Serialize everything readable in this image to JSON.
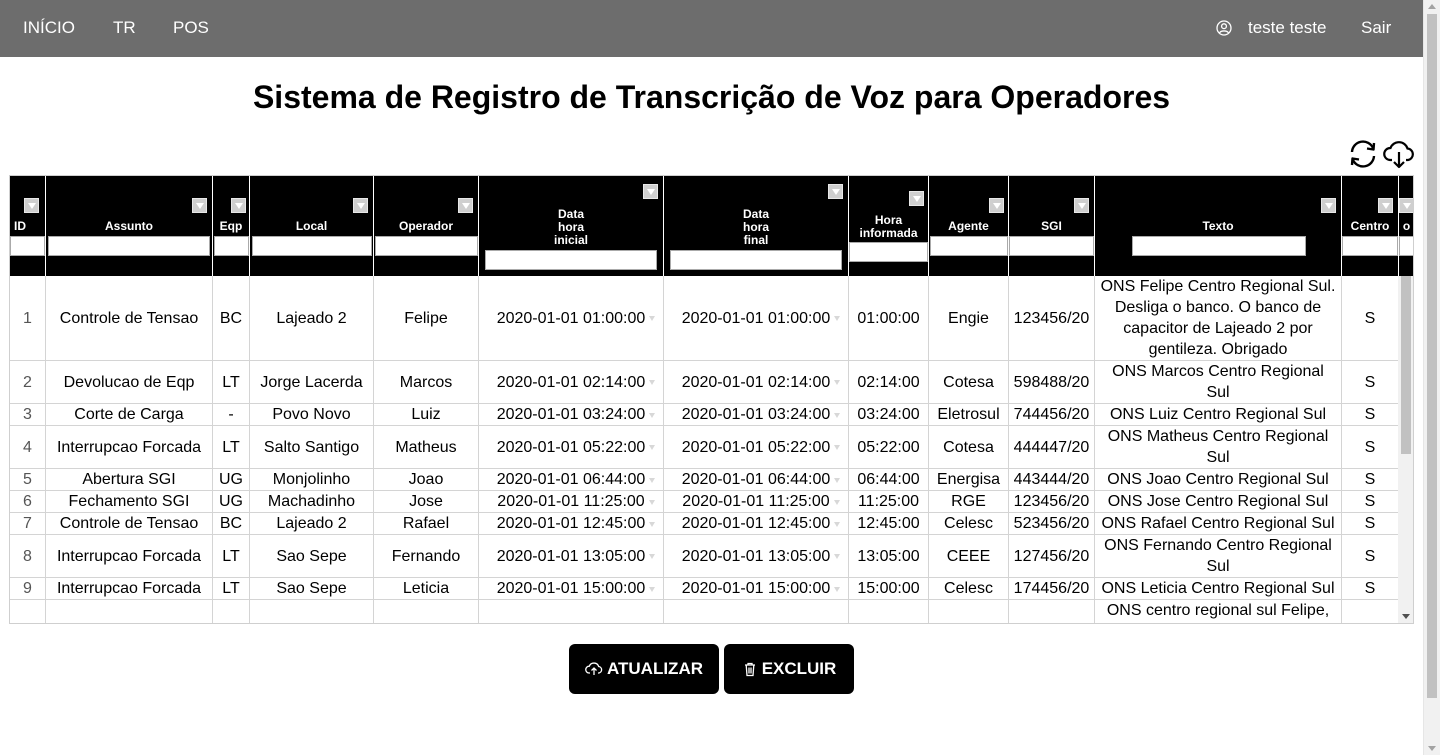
{
  "nav": {
    "links": [
      "INÍCIO",
      "TR",
      "POS"
    ],
    "user_name": "teste teste",
    "logout": "Sair"
  },
  "page_title": "Sistema de Registro de Transcrição de Voz para Operadores",
  "toolbar": {
    "refresh_icon": "refresh-icon",
    "download_icon": "cloud-download-icon"
  },
  "grid": {
    "columns": [
      {
        "key": "id",
        "label": "ID"
      },
      {
        "key": "assunto",
        "label": "Assunto"
      },
      {
        "key": "eqp",
        "label": "Eqp"
      },
      {
        "key": "local",
        "label": "Local"
      },
      {
        "key": "operador",
        "label": "Operador"
      },
      {
        "key": "inicial",
        "label": "Data\nhora\ninicial"
      },
      {
        "key": "final",
        "label": "Data\nhora\nfinal"
      },
      {
        "key": "informada",
        "label": "Hora\ninformada"
      },
      {
        "key": "agente",
        "label": "Agente"
      },
      {
        "key": "sgi",
        "label": "SGI"
      },
      {
        "key": "texto",
        "label": "Texto"
      },
      {
        "key": "centro",
        "label": "Centro"
      },
      {
        "key": "extra",
        "label": "o"
      }
    ],
    "rows": [
      {
        "id": "1",
        "assunto": "Controle de Tensao",
        "eqp": "BC",
        "local": "Lajeado 2",
        "operador": "Felipe",
        "inicial": "2020-01-01 01:00:00",
        "final": "2020-01-01 01:00:00",
        "informada": "01:00:00",
        "agente": "Engie",
        "sgi": "123456/20",
        "texto": "ONS Felipe Centro Regional Sul. Desliga o banco. O banco de capacitor de Lajeado 2 por gentileza. Obrigado",
        "centro": "S"
      },
      {
        "id": "2",
        "assunto": "Devolucao de Eqp",
        "eqp": "LT",
        "local": "Jorge Lacerda",
        "operador": "Marcos",
        "inicial": "2020-01-01 02:14:00",
        "final": "2020-01-01 02:14:00",
        "informada": "02:14:00",
        "agente": "Cotesa",
        "sgi": "598488/20",
        "texto": "ONS Marcos Centro Regional Sul",
        "centro": "S"
      },
      {
        "id": "3",
        "assunto": "Corte de Carga",
        "eqp": "-",
        "local": "Povo Novo",
        "operador": "Luiz",
        "inicial": "2020-01-01 03:24:00",
        "final": "2020-01-01 03:24:00",
        "informada": "03:24:00",
        "agente": "Eletrosul",
        "sgi": "744456/20",
        "texto": "ONS Luiz Centro Regional Sul",
        "centro": "S"
      },
      {
        "id": "4",
        "assunto": "Interrupcao Forcada",
        "eqp": "LT",
        "local": "Salto Santigo",
        "operador": "Matheus",
        "inicial": "2020-01-01 05:22:00",
        "final": "2020-01-01 05:22:00",
        "informada": "05:22:00",
        "agente": "Cotesa",
        "sgi": "444447/20",
        "texto": "ONS Matheus Centro Regional Sul",
        "centro": "S"
      },
      {
        "id": "5",
        "assunto": "Abertura SGI",
        "eqp": "UG",
        "local": "Monjolinho",
        "operador": "Joao",
        "inicial": "2020-01-01 06:44:00",
        "final": "2020-01-01 06:44:00",
        "informada": "06:44:00",
        "agente": "Energisa",
        "sgi": "443444/20",
        "texto": "ONS Joao Centro Regional Sul",
        "centro": "S"
      },
      {
        "id": "6",
        "assunto": "Fechamento SGI",
        "eqp": "UG",
        "local": "Machadinho",
        "operador": "Jose",
        "inicial": "2020-01-01 11:25:00",
        "final": "2020-01-01 11:25:00",
        "informada": "11:25:00",
        "agente": "RGE",
        "sgi": "123456/20",
        "texto": "ONS Jose Centro Regional Sul",
        "centro": "S"
      },
      {
        "id": "7",
        "assunto": "Controle de Tensao",
        "eqp": "BC",
        "local": "Lajeado 2",
        "operador": "Rafael",
        "inicial": "2020-01-01 12:45:00",
        "final": "2020-01-01 12:45:00",
        "informada": "12:45:00",
        "agente": "Celesc",
        "sgi": "523456/20",
        "texto": "ONS Rafael Centro Regional Sul",
        "centro": "S"
      },
      {
        "id": "8",
        "assunto": "Interrupcao Forcada",
        "eqp": "LT",
        "local": "Sao Sepe",
        "operador": "Fernando",
        "inicial": "2020-01-01 13:05:00",
        "final": "2020-01-01 13:05:00",
        "informada": "13:05:00",
        "agente": "CEEE",
        "sgi": "127456/20",
        "texto": "ONS Fernando Centro Regional Sul",
        "centro": "S"
      },
      {
        "id": "9",
        "assunto": "Interrupcao Forcada",
        "eqp": "LT",
        "local": "Sao Sepe",
        "operador": "Leticia",
        "inicial": "2020-01-01 15:00:00",
        "final": "2020-01-01 15:00:00",
        "informada": "15:00:00",
        "agente": "Celesc",
        "sgi": "174456/20",
        "texto": "ONS Leticia Centro Regional Sul",
        "centro": "S"
      },
      {
        "id": "",
        "assunto": "",
        "eqp": "",
        "local": "",
        "operador": "",
        "inicial": "",
        "final": "",
        "informada": "",
        "agente": "",
        "sgi": "",
        "texto": "ONS centro regional sul Felipe,",
        "centro": ""
      }
    ]
  },
  "buttons": {
    "update": "ATUALIZAR",
    "delete": "EXCLUIR"
  }
}
